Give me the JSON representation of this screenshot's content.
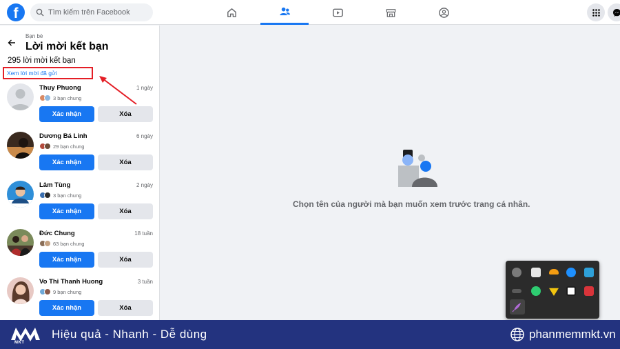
{
  "topbar": {
    "logo": "f",
    "search_placeholder": "Tìm kiếm trên Facebook",
    "tabs": [
      {
        "icon": "home-icon",
        "active": false
      },
      {
        "icon": "friends-icon",
        "active": true
      },
      {
        "icon": "watch-icon",
        "active": false
      },
      {
        "icon": "marketplace-icon",
        "active": false
      },
      {
        "icon": "groups-icon",
        "active": false
      }
    ],
    "right_icons": [
      "menu-grid-icon",
      "messenger-icon"
    ]
  },
  "sidebar": {
    "breadcrumb": "Bạn bè",
    "title": "Lời mời kết bạn",
    "count": "295 lời mời kết bạn",
    "sent_link": "Xem lời mời đã gửi",
    "requests": [
      {
        "name": "Thuy Phuong",
        "time": "1 ngày",
        "mutual": "3 bạn chung"
      },
      {
        "name": "Dương Bá Linh",
        "time": "6 ngày",
        "mutual": "29 bạn chung"
      },
      {
        "name": "Lâm Tùng",
        "time": "2 ngày",
        "mutual": "3 bạn chung"
      },
      {
        "name": "Đức Chung",
        "time": "18 tuần",
        "mutual": "63 bạn chung"
      },
      {
        "name": "Vo Thi Thanh Huong",
        "time": "3 tuần",
        "mutual": "9 bạn chung"
      }
    ],
    "confirm_label": "Xác nhận",
    "delete_label": "Xóa"
  },
  "main": {
    "empty_message": "Chọn tên của người mà bạn muốn xem trước trang cá nhân."
  },
  "footer": {
    "brand": "MKT",
    "brand_caption": "MKT",
    "slogan": "Hiệu quả - Nhanh - Dễ dùng",
    "website": "phanmemmkt.vn"
  },
  "colors": {
    "facebook_blue": "#1877f2",
    "footer_bg": "#23337f",
    "annotation_red": "#e41e26"
  }
}
